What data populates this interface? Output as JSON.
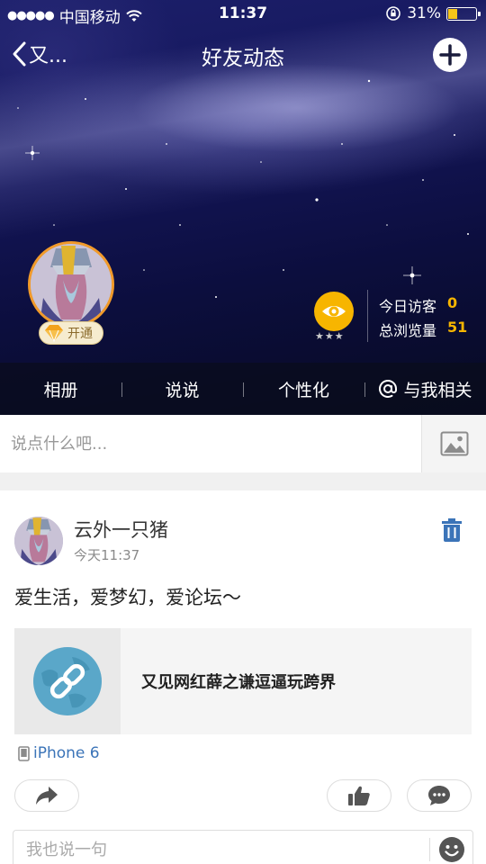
{
  "status_bar": {
    "signal_dots": "●●●●●",
    "carrier": "中国移动",
    "time": "11:37",
    "battery_percent": "31%",
    "battery_level": 0.31,
    "battery_color": "#f5c518"
  },
  "nav": {
    "back_label": "又...",
    "title": "好友动态",
    "add_icon": "plus-icon"
  },
  "profile": {
    "vip_label": "开通",
    "visitor_level_stars": "★★★",
    "stats": [
      {
        "label": "今日访客",
        "value": "0"
      },
      {
        "label": "总浏览量",
        "value": "51"
      }
    ],
    "accent_color": "#f7b500"
  },
  "tabs": [
    {
      "label": "相册"
    },
    {
      "label": "说说"
    },
    {
      "label": "个性化"
    },
    {
      "label": "与我相关",
      "icon": "at-icon"
    }
  ],
  "compose": {
    "placeholder": "说点什么吧..."
  },
  "post": {
    "author": "云外一只猪",
    "time": "今天11:37",
    "text": "爱生活，爱梦幻，爱论坛～",
    "link_title": "又见网红薛之谦逗逼玩跨界",
    "device": "iPhone 6",
    "device_color": "#3b74b8"
  },
  "comment": {
    "placeholder": "我也说一句"
  }
}
